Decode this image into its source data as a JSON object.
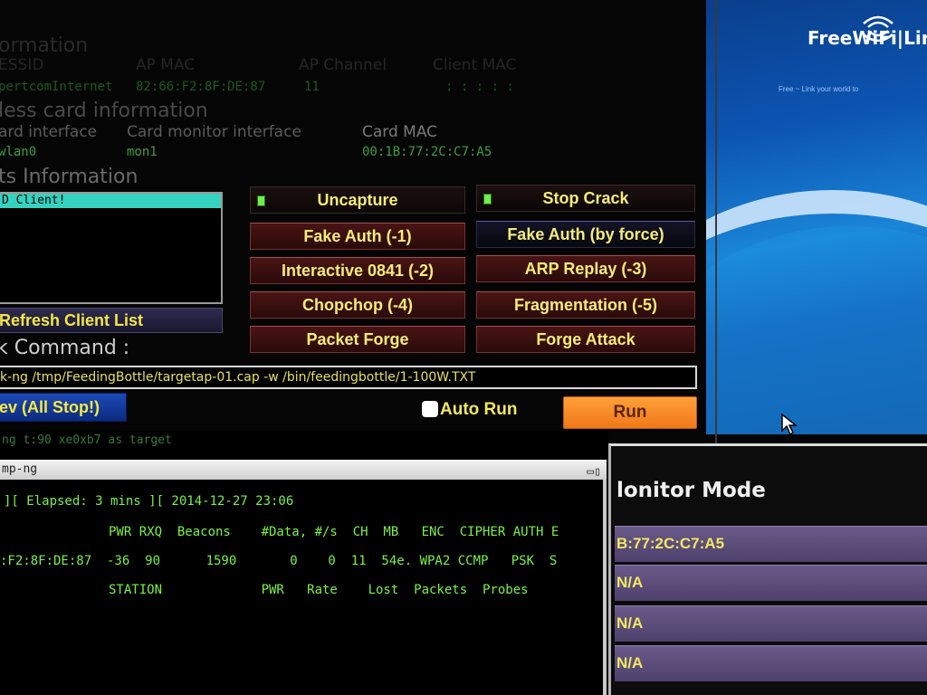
{
  "info": {
    "ap_head": "ormation",
    "ap_cols": {
      "essid": "ESSID",
      "ap_mac": "AP MAC",
      "ap_channel": "AP Channel",
      "client_mac": "Client MAC"
    },
    "ap_vals": {
      "essid": "pertcomInternet",
      "ap_mac": "82:66:F2:8F:DE:87",
      "ap_channel": "11",
      "client_mac": ": : : : :"
    },
    "wireless_head": "less card information",
    "wireless_cols": {
      "interface": "ard interface",
      "monitor": "Card monitor interface",
      "mac": "Card MAC"
    },
    "wireless_vals": {
      "interface": "wlan0",
      "monitor": "mon1",
      "mac": "00:1B:77:2C:C7:A5"
    },
    "clients_head": "ts Information"
  },
  "clients": {
    "selected": "D Client!"
  },
  "buttons": {
    "uncapture": "Uncapture",
    "stop_crack": "Stop Crack",
    "fake_auth": "Fake Auth  (-1)",
    "fake_auth_force": "Fake Auth (by force)",
    "interactive": "Interactive 0841  (-2)",
    "arp_replay": "ARP Replay  (-3)",
    "chopchop": "Chopchop (-4)",
    "fragmentation": "Fragmentation (-5)",
    "packet_forge": "Packet Forge",
    "forge_attack": "Forge Attack",
    "refresh": "Refresh Client List",
    "stop_all": "ev (All Stop!)",
    "run": "Run"
  },
  "command": {
    "label": "k Command :",
    "value": "k-ng /tmp/FeedingBottle/targetap-01.cap -w /bin/feedingbottle/1-100W.TXT"
  },
  "autorun": {
    "label": "Auto Run",
    "checked": false
  },
  "terminal": {
    "strip_text": "ng t:90 xe0xb7 as target",
    "title": "mp-ng",
    "ctrl_glyphs": "▭▯",
    "status_line": "][ Elapsed: 3 mins ][ 2014-12-27 23:06",
    "ap_header": "PWR RXQ  Beacons    #Data, #/s  CH  MB   ENC  CIPHER AUTH E",
    "ap_row": ":F2:8F:DE:87  -36  90      1590       0    0  11  54e. WPA2 CCMP   PSK  S",
    "station_header": "STATION             PWR   Rate    Lost  Packets  Probes"
  },
  "monitor": {
    "title": "lonitor Mode",
    "rows": [
      "B:77:2C:C7:A5",
      "N/A",
      "N/A",
      "N/A"
    ]
  },
  "wallpaper": {
    "logo": "FreeWiFi|Lin",
    "tagline": "Free ~ Link your world to"
  },
  "colors": {
    "button_text": "#f5ec7a",
    "terminal_green": "#7cf04a",
    "run_orange": "#f58a28",
    "led_green": "#6ef04a",
    "monitor_row": "#5c4e7c"
  }
}
